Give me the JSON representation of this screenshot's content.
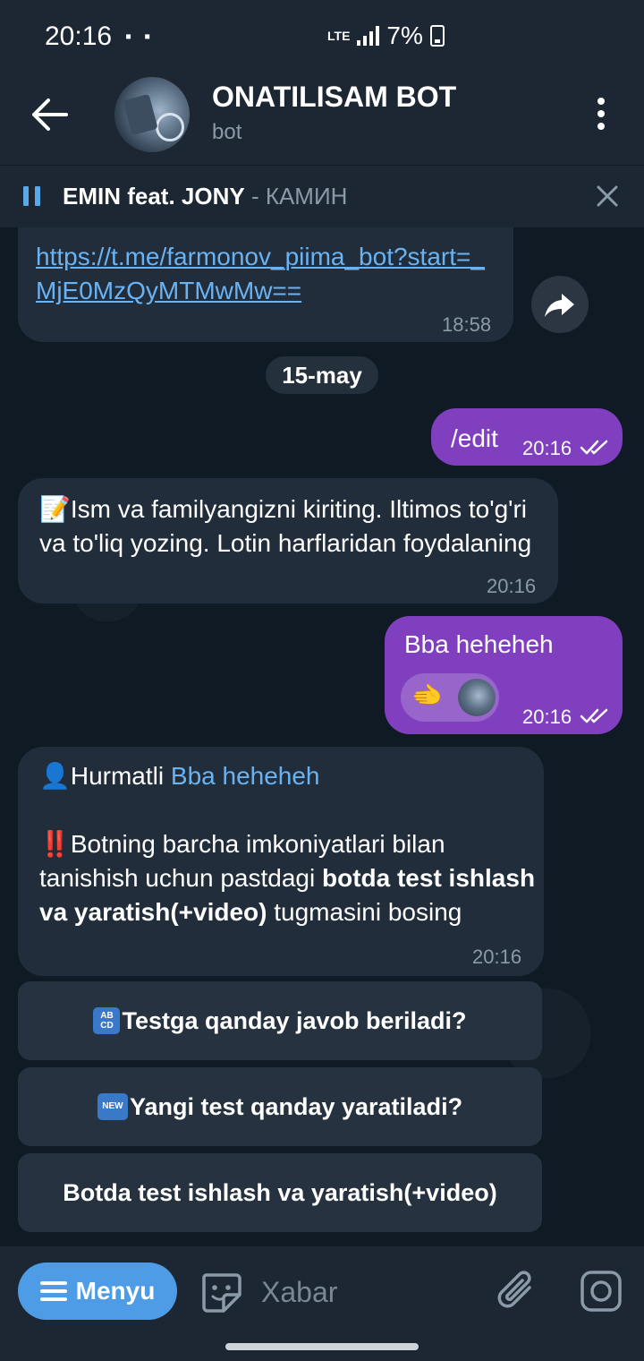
{
  "status_bar": {
    "time": "20:16",
    "network": "LTE",
    "battery": "7%"
  },
  "header": {
    "title": "ONATILISAM BOT",
    "subtitle": "bot"
  },
  "music_bar": {
    "artist": "EMIN feat. JONY",
    "track": " - КАМИН"
  },
  "messages": {
    "link": {
      "text": "https://t.me/farmonov_piima_bot?start=_MjE0MzQyMTMwMw==",
      "time": "18:58"
    },
    "date_separator": "15-may",
    "edit": {
      "text": "/edit",
      "time": "20:16"
    },
    "prompt": {
      "text": "📝Ism va familyangizni kiriting. Iltimos to'g'ri va to'liq yozing. Lotin harflaridan foydalaning",
      "time": "20:16"
    },
    "name_reply": {
      "text": "Bba heheheh",
      "emoji": "🫲",
      "time": "20:16"
    },
    "info": {
      "greeting": "👤Hurmatli ",
      "name": "Bba heheheh",
      "body_start": "‼️Botning barcha imkoniyatlari bilan tanishish uchun pastdagi ",
      "body_bold": "botda test ishlash va yaratish(+video)",
      "body_end": " tugmasini bosing",
      "time": "20:16"
    }
  },
  "keyboard": {
    "button1": {
      "icon": "AB CD",
      "label": "Testga qanday javob beriladi?"
    },
    "button2": {
      "icon": "NEW",
      "label": "Yangi test qanday yaratiladi?"
    },
    "button3": {
      "label": "Botda test ishlash va yaratish(+video)"
    }
  },
  "input_bar": {
    "menu_label": "Menyu",
    "placeholder": "Xabar"
  },
  "colors": {
    "outgoing_bubble": "#7f3fbf",
    "incoming_bubble": "#212d3b",
    "link": "#6ab3f3",
    "menu_button": "#4e9ce5"
  }
}
